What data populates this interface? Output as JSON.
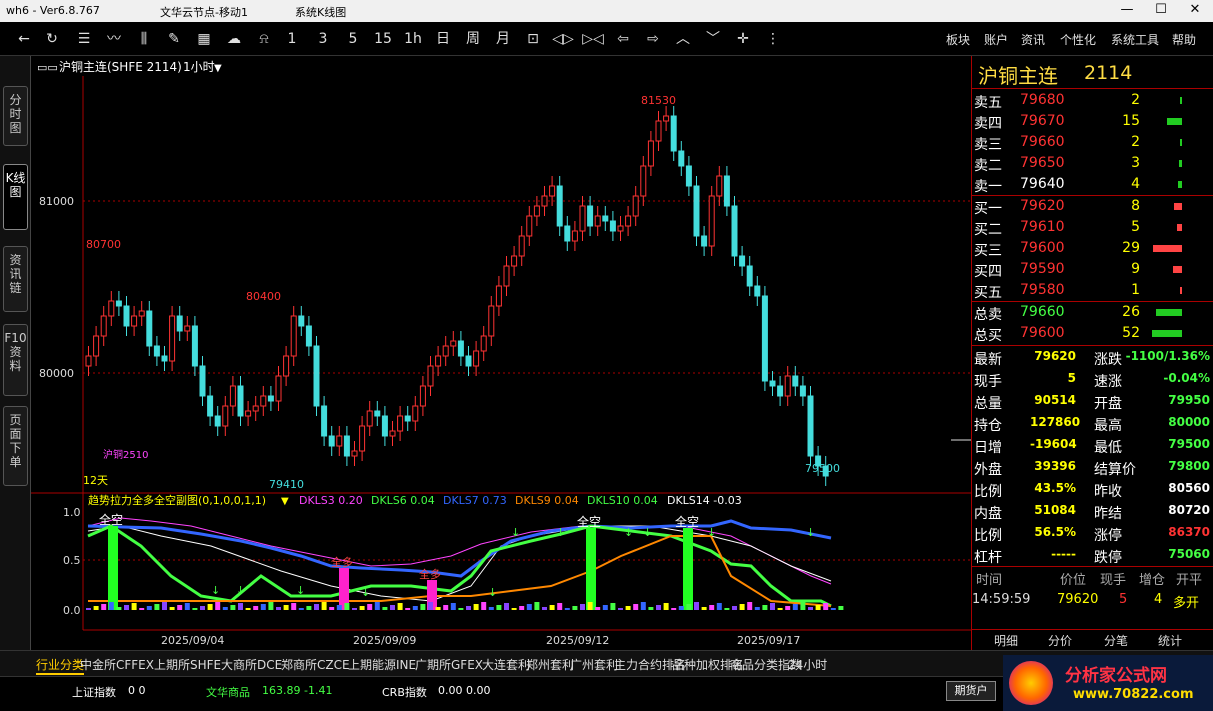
{
  "titlebar": {
    "app": "wh6 - Ver6.8.767",
    "server": "文华云节点-移动1",
    "mode": "系统K线图"
  },
  "toolbar": {
    "period_buttons": [
      "1",
      "3",
      "5",
      "15",
      "1h",
      "日",
      "周",
      "月"
    ],
    "menus": [
      "板块",
      "账户",
      "资讯",
      "个性化",
      "系统工具",
      "帮助"
    ]
  },
  "left_tabs": [
    "分时图",
    "K线图",
    "资讯链",
    "F10资料",
    "页面下单"
  ],
  "chart": {
    "header": "沪铜主连(SHFE 2114)",
    "period": "1小时",
    "y_labels": [
      "81000",
      "80000"
    ],
    "price_marks": [
      "81530",
      "80700",
      "80400",
      "79410",
      "79500"
    ],
    "volume_label": "12天",
    "contract_label": "沪铜2510",
    "indicator": {
      "name": "趋势拉力全多全空副图(0,1,0,0,1,1)",
      "values": [
        {
          "label": "DKLS3 0.20",
          "color": "#ff44ff"
        },
        {
          "label": "DKLS6 0.04",
          "color": "#44ff44"
        },
        {
          "label": "DKLS7 0.73",
          "color": "#3366ff"
        },
        {
          "label": "DKLS9 0.04",
          "color": "#ff8800"
        },
        {
          "label": "DKLS10 0.04",
          "color": "#44ff44"
        },
        {
          "label": "DKLS14 -0.03",
          "color": "#ffffff"
        }
      ]
    },
    "sub_y_labels": [
      "1.0",
      "0.5",
      "0.0"
    ],
    "signal_labels": [
      "全空",
      "全多",
      "全多",
      "全空",
      "全空"
    ],
    "x_labels": [
      "2025/09/04",
      "2025/09/09",
      "2025/09/12",
      "2025/09/17"
    ]
  },
  "quote": {
    "name": "沪铜主连",
    "code": "2114",
    "asks": [
      {
        "label": "卖五",
        "price": "79680",
        "vol": "2"
      },
      {
        "label": "卖四",
        "price": "79670",
        "vol": "15"
      },
      {
        "label": "卖三",
        "price": "79660",
        "vol": "2"
      },
      {
        "label": "卖二",
        "price": "79650",
        "vol": "3"
      },
      {
        "label": "卖一",
        "price": "79640",
        "vol": "4"
      }
    ],
    "bids": [
      {
        "label": "买一",
        "price": "79620",
        "vol": "8"
      },
      {
        "label": "买二",
        "price": "79610",
        "vol": "5"
      },
      {
        "label": "买三",
        "price": "79600",
        "vol": "29"
      },
      {
        "label": "买四",
        "price": "79590",
        "vol": "9"
      },
      {
        "label": "买五",
        "price": "79580",
        "vol": "1"
      }
    ],
    "totals": [
      {
        "label": "总卖",
        "price": "79660",
        "vol": "26"
      },
      {
        "label": "总买",
        "price": "79600",
        "vol": "52"
      }
    ],
    "stats": [
      [
        "最新",
        "79620",
        "涨跌",
        "-1100/1.36%"
      ],
      [
        "现手",
        "5",
        "速涨",
        "-0.04%"
      ],
      [
        "总量",
        "90514",
        "开盘",
        "79950"
      ],
      [
        "持仓",
        "127860",
        "最高",
        "80000"
      ],
      [
        "日增",
        "-19604",
        "最低",
        "79500"
      ],
      [
        "外盘",
        "39396",
        "结算价",
        "79800"
      ],
      [
        "比例",
        "43.5%",
        "昨收",
        "80560"
      ],
      [
        "内盘",
        "51084",
        "昨结",
        "80720"
      ],
      [
        "比例",
        "56.5%",
        "涨停",
        "86370"
      ],
      [
        "杠杆",
        "-----",
        "跌停",
        "75060"
      ]
    ],
    "ticks_header": [
      "时间",
      "价位",
      "现手",
      "增仓",
      "开平"
    ],
    "tick": {
      "time": "14:59:59",
      "price": "79620",
      "vol": "5",
      "oi": "4",
      "type": "多开"
    },
    "tabs": [
      "明细",
      "分价",
      "分笔",
      "统计"
    ]
  },
  "bottom_tabs": [
    "行业分类",
    "中金所CFFEX",
    "上期所SHFE",
    "大商所DCE",
    "郑商所CZCE",
    "上期能源INE",
    "广期所GFEX",
    "大连套利",
    "郑州套利",
    "广州套利",
    "主力合约排名",
    "品种加权排名",
    "商品分类指数",
    "24小时"
  ],
  "status": {
    "idx1_label": "上证指数",
    "idx1_val": "0  0",
    "idx2_label": "文华商品",
    "idx2_val": "163.89  -1.41",
    "idx3_label": "CRB指数",
    "idx3_val": "0.00  0.00",
    "btn": "期货户",
    "logo": "分析家公式网",
    "logo_url": "www.70822.com"
  }
}
